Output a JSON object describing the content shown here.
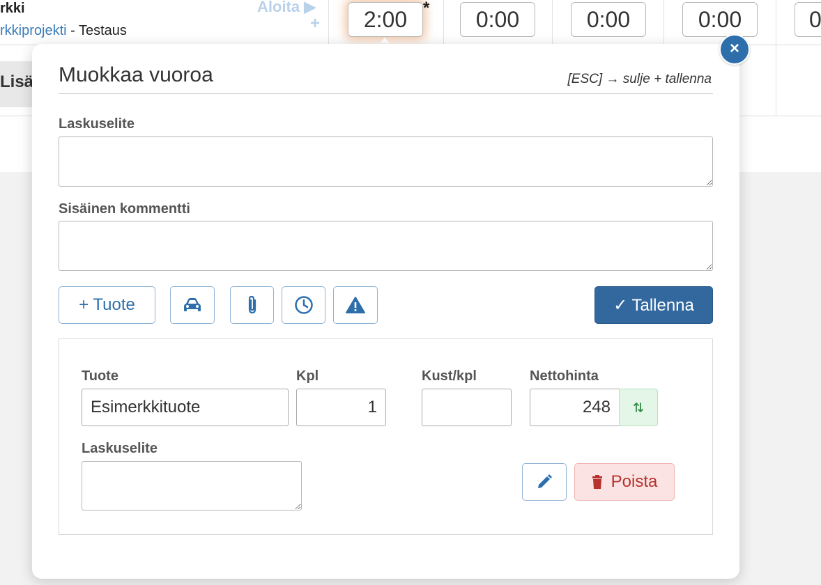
{
  "background": {
    "project_name": "rkki",
    "project_link": "rkkiprojekti",
    "project_sub": " - Testaus",
    "start_label": "Aloita ▶",
    "plus_label": "+",
    "times": [
      "2:00",
      "0:00",
      "0:00",
      "0:00",
      "0"
    ],
    "asterisk": "*",
    "add_label": "Lisä"
  },
  "modal": {
    "close_label": "×",
    "title": "Muokkaa vuoroa",
    "esc_hint": "[ESC] → sulje + tallenna",
    "invoice_label": "Laskuselite",
    "invoice_value": "",
    "comment_label": "Sisäinen kommentti",
    "comment_value": "",
    "toolbar": {
      "product_button": "+ Tuote",
      "car_icon": "car-icon",
      "attach_icon": "paperclip-icon",
      "clock_icon": "clock-icon",
      "warning_icon": "warning-icon",
      "save_button": "✓ Tallenna"
    },
    "product": {
      "name_label": "Tuote",
      "name_value": "Esimerkkituote",
      "qty_label": "Kpl",
      "qty_value": "1",
      "cost_label": "Kust/kpl",
      "cost_value": "",
      "net_label": "Nettohinta",
      "net_value": "248",
      "invoice_label": "Laskuselite",
      "invoice_value": "",
      "edit_icon": "pencil-icon",
      "delete_button": "Poista",
      "delete_icon": "trash-icon"
    }
  },
  "colors": {
    "primary": "#33689e",
    "accent_link": "#3a7ab8",
    "danger_bg": "#fbe3e3",
    "danger_text": "#b5322e",
    "success_bg": "#e4f6e7"
  }
}
